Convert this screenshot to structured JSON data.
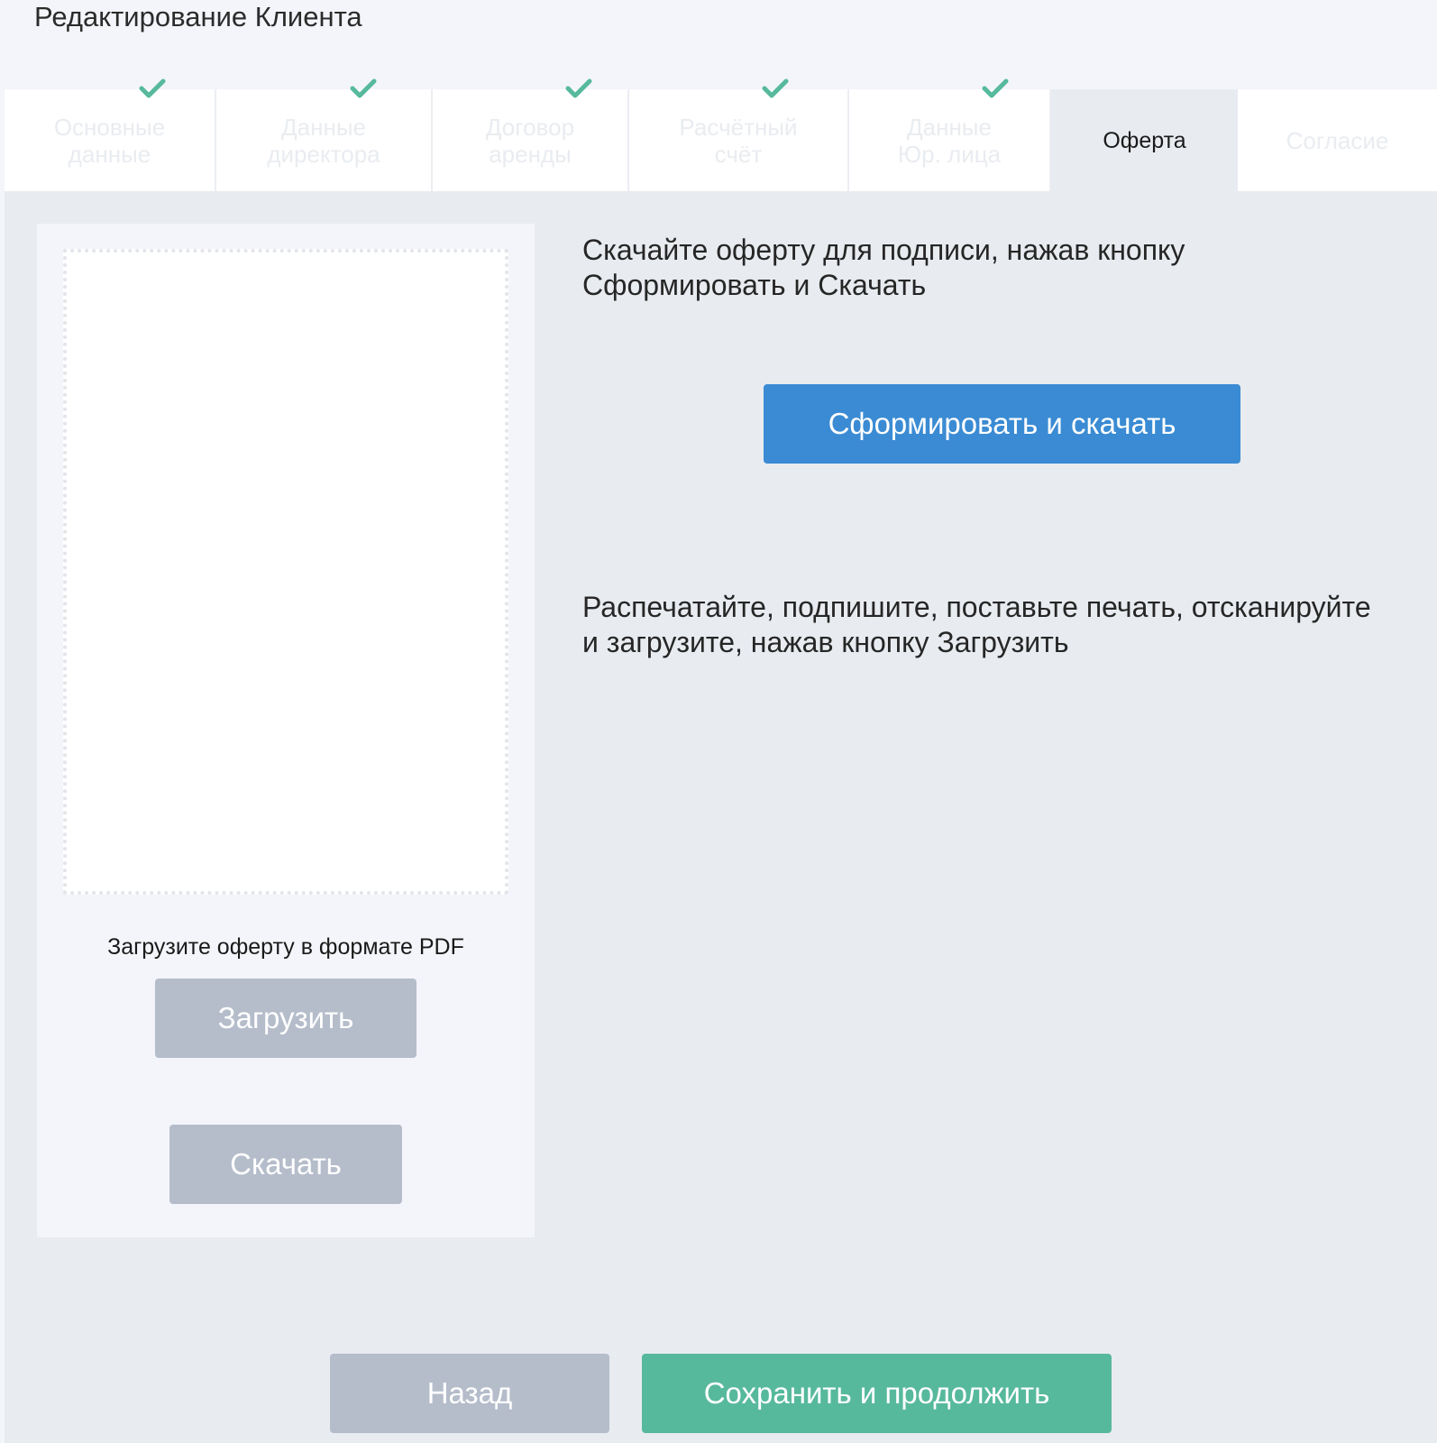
{
  "page": {
    "title": "Редактирование Клиента"
  },
  "tabs": [
    {
      "label": "Основные\nданные",
      "completed": true,
      "active": false
    },
    {
      "label": "Данные\nдиректора",
      "completed": true,
      "active": false
    },
    {
      "label": "Договор\nаренды",
      "completed": true,
      "active": false
    },
    {
      "label": "Расчётный\nсчёт",
      "completed": true,
      "active": false
    },
    {
      "label": "Данные\nЮр. лица",
      "completed": true,
      "active": false
    },
    {
      "label": "Оферта",
      "completed": false,
      "active": true
    },
    {
      "label": "Согласие",
      "completed": false,
      "active": false
    }
  ],
  "upload": {
    "hint": "Загрузите оферту в формате PDF",
    "upload_label": "Загрузить",
    "download_label": "Скачать"
  },
  "instructions": {
    "step1": "Скачайте оферту для подписи, нажав кнопку\nСформировать и Скачать",
    "generate_label": "Сформировать и скачать",
    "step2": "Распечатайте, подпишите, поставьте печать, отсканируйте\nи загрузите, нажав кнопку Загрузить"
  },
  "footer": {
    "back_label": "Назад",
    "save_label": "Сохранить и продолжить"
  },
  "colors": {
    "check": "#57b99c",
    "primary": "#3a8bd3",
    "success": "#57b99c",
    "muted": "#b5bdcb"
  },
  "icons": {
    "tab_completed": "check-icon"
  }
}
